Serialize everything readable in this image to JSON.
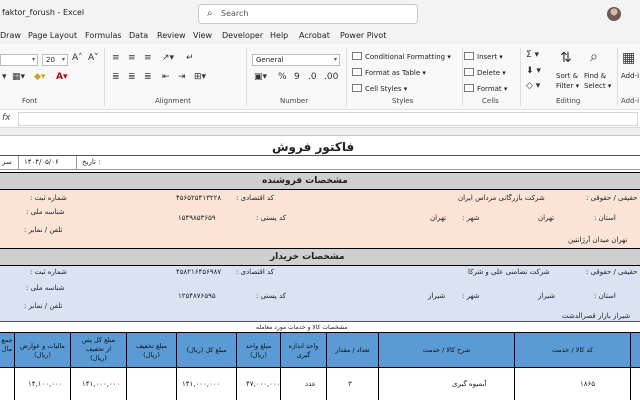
{
  "window": {
    "title": "faktor_forush  -  Excel"
  },
  "search": {
    "placeholder": "Search"
  },
  "menu": [
    "Draw",
    "Page Layout",
    "Formulas",
    "Data",
    "Review",
    "View",
    "Developer",
    "Help",
    "Acrobat",
    "Power Pivot"
  ],
  "ribbon": {
    "font_size": "20",
    "number_format": "General",
    "groups": {
      "font": "Font",
      "alignment": "Alignment",
      "number": "Number",
      "styles": "Styles",
      "cells": "Cells",
      "editing": "Editing",
      "addins": "Add-i"
    },
    "styles": {
      "conditional": "Conditional Formatting",
      "table": "Format as Table",
      "cell": "Cell Styles"
    },
    "cells": {
      "insert": "Insert",
      "delete": "Delete",
      "format": "Format"
    },
    "editing": {
      "sort": "Sort &",
      "filter": "Filter",
      "find": "Find &",
      "select": "Select",
      "addin": "Add-i"
    }
  },
  "formula": {
    "fx": "fx"
  },
  "sheet": {
    "title": "فاکتور فروش",
    "date_label": "تاریخ :",
    "date_value": "۱۴۰۴/۰۵/۰۶",
    "serial_label": "سر",
    "seller": {
      "header": "مشخصات فروشنده",
      "type_label": "حقیقی / حقوقی :",
      "name": "شرکت بازرگانی مرداس ایران",
      "econ_label": "کد اقتصادی :",
      "econ_value": "۴۵۶۵۲۵۴۱۳۲۲۸",
      "reg_label": "شماره ثبت :",
      "province_label": "استان :",
      "province_value": "تهران",
      "city_label": "شهر :",
      "city_value": "تهران",
      "postal_label": "کد پستی :",
      "postal_value": "۱۵۴۹۸۵۳۶۵۹",
      "national_label": "شناسه ملی :",
      "phone_label": "تلفن / نمابر :",
      "address": "تهران میدان آرژانتین"
    },
    "buyer": {
      "header": "مشخصات خریدار",
      "type_label": "حقیقی / حقوقی :",
      "name": "شرکت تضامنی علی و شرکا",
      "econ_label": "کد اقتصادی :",
      "econ_value": "۴۵۸۲۱۶۴۵۶۹۸۷",
      "reg_label": "شماره ثبت :",
      "province_label": "استان :",
      "province_value": "شیراز",
      "city_label": "شهر :",
      "city_value": "شیراز",
      "postal_label": "کد پستی :",
      "postal_value": "۱۲۵۴۸۷۶۵۹۵",
      "national_label": "شناسه ملی :",
      "phone_label": "تلفن / نمابر :",
      "address": "شیراز بازار قصرالدشت"
    },
    "items_caption": "مشخصات کالا و خدمات مورد معامله",
    "columns": [
      "جمع\nمال",
      "مالیات و عوارض\n(ریال)",
      "مبلغ کل پس\nاز تخفیف\n(ریال)",
      "مبلغ تخفیف\n(ریال)",
      "مبلغ کل (ریال)",
      "مبلغ واحد\n(ریال)",
      "واحد اندازه\nگیری",
      "تعداد / مقدار",
      "شرح کالا / خدمت",
      "کد کالا / خدمت"
    ],
    "row": {
      "code": "۱۸۶۵",
      "description": "آبمیوه گیری",
      "qty": "۳",
      "unit": "عدد",
      "unit_price": "۴۷,۰۰۰,۰۰۰",
      "total": "۱۴۱,۰۰۰,۰۰۰",
      "discount": "",
      "after_discount": "۱۴۱,۰۰۰,۰۰۰",
      "tax": "۱۴,۱۰۰,۰۰۰"
    }
  },
  "colors": {
    "seller_band": "#fbe3d6",
    "buyer_band": "#dae3f3",
    "section_header": "#cfcfcf",
    "table_header": "#5b9bd5"
  }
}
